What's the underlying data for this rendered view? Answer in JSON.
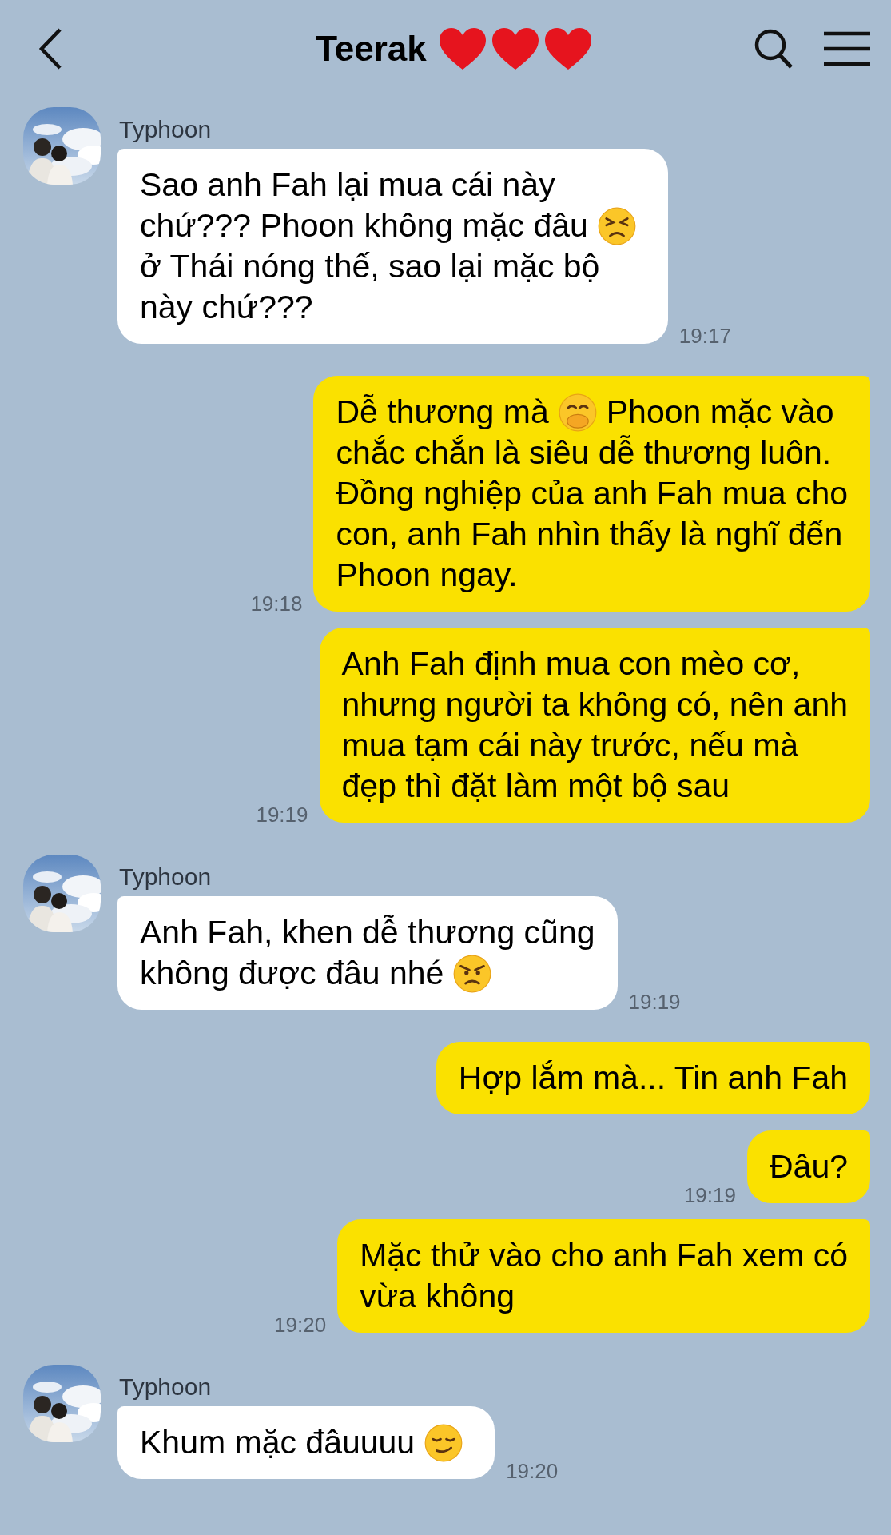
{
  "header": {
    "title": {
      "text": "Teerak",
      "icons": [
        {
          "kind": "heart"
        },
        {
          "kind": "heart"
        },
        {
          "kind": "heart"
        }
      ]
    }
  },
  "messages": [
    {
      "kind": "received",
      "name": "Typhoon",
      "time": "19:17",
      "lines": [
        [
          {
            "kind": "text",
            "text": "Sao anh Fah lại mua cái này"
          }
        ],
        [
          {
            "kind": "text",
            "text": "chứ??? Phoon không mặc đâu"
          },
          {
            "kind": "tired-face"
          }
        ],
        [
          {
            "kind": "text",
            "text": "ở Thái nóng thế, sao lại mặc bộ"
          }
        ],
        [
          {
            "kind": "text",
            "text": "này chứ???"
          }
        ]
      ]
    },
    {
      "kind": "sent",
      "time": "19:18",
      "lines": [
        [
          {
            "kind": "text",
            "text": "Dễ thương mà"
          },
          {
            "kind": "hand-over-mouth"
          },
          {
            "kind": "text",
            "text": "Phoon mặc vào"
          }
        ],
        [
          {
            "kind": "text",
            "text": "chắc chắn là siêu dễ thương luôn."
          }
        ],
        [
          {
            "kind": "text",
            "text": "Đồng nghiệp của anh Fah mua cho"
          }
        ],
        [
          {
            "kind": "text",
            "text": "con, anh Fah nhìn thấy là nghĩ đến"
          }
        ],
        [
          {
            "kind": "text",
            "text": "Phoon ngay."
          }
        ]
      ]
    },
    {
      "kind": "sent",
      "time": "19:19",
      "lines": [
        [
          {
            "kind": "text",
            "text": "Anh Fah định mua con mèo cơ,"
          }
        ],
        [
          {
            "kind": "text",
            "text": "nhưng người ta không có, nên anh"
          }
        ],
        [
          {
            "kind": "text",
            "text": "mua tạm cái này trước, nếu mà"
          }
        ],
        [
          {
            "kind": "text",
            "text": "đẹp thì đặt làm một bộ sau"
          }
        ]
      ]
    },
    {
      "kind": "received",
      "name": "Typhoon",
      "time": "19:19",
      "lines": [
        [
          {
            "kind": "text",
            "text": "Anh Fah, khen dễ thương cũng"
          }
        ],
        [
          {
            "kind": "text",
            "text": "không được đâu nhé"
          },
          {
            "kind": "angry-face"
          }
        ]
      ]
    },
    {
      "kind": "sent",
      "lines": [
        [
          {
            "kind": "text",
            "text": "Hợp lắm mà... Tin anh Fah"
          }
        ]
      ]
    },
    {
      "kind": "sent",
      "time": "19:19",
      "lines": [
        [
          {
            "kind": "text",
            "text": "Đâu?"
          }
        ]
      ]
    },
    {
      "kind": "sent",
      "time": "19:20",
      "lines": [
        [
          {
            "kind": "text",
            "text": "Mặc thử vào cho anh Fah xem có"
          }
        ],
        [
          {
            "kind": "text",
            "text": "vừa không"
          }
        ]
      ]
    },
    {
      "kind": "received",
      "name": "Typhoon",
      "time": "19:20",
      "lines": [
        [
          {
            "kind": "text",
            "text": "Khum mặc đâuuuu"
          },
          {
            "kind": "smirk-face"
          }
        ]
      ]
    }
  ]
}
